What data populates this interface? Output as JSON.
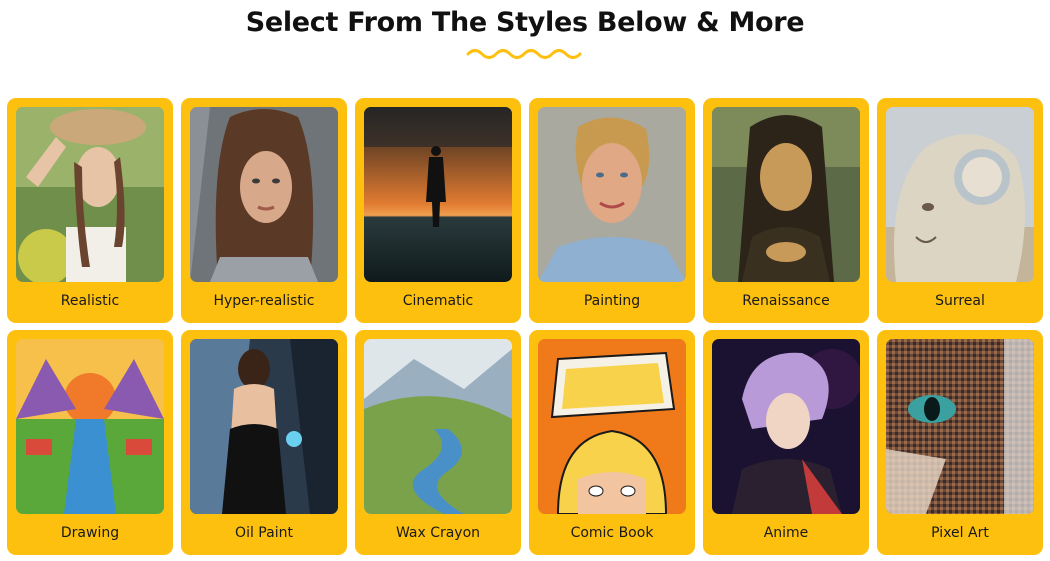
{
  "header": {
    "title": "Select From The Styles Below & More",
    "accent_color": "#FDC00F"
  },
  "styles": [
    {
      "label": "Realistic",
      "image": "woman-with-sun-hat-photo"
    },
    {
      "label": "Hyper-realistic",
      "image": "woman-portrait-photo"
    },
    {
      "label": "Cinematic",
      "image": "silhouette-sunset-sea"
    },
    {
      "label": "Painting",
      "image": "painted-portrait-woman"
    },
    {
      "label": "Renaissance",
      "image": "mona-lisa"
    },
    {
      "label": "Surreal",
      "image": "surreal-stone-face"
    },
    {
      "label": "Drawing",
      "image": "colored-landscape-drawing"
    },
    {
      "label": "Oil Paint",
      "image": "oil-painting-woman-glass"
    },
    {
      "label": "Wax Crayon",
      "image": "crayon-river-valley"
    },
    {
      "label": "Comic Book",
      "image": "comic-book-cover"
    },
    {
      "label": "Anime",
      "image": "anime-boy"
    },
    {
      "label": "Pixel Art",
      "image": "pixel-cat"
    }
  ],
  "card_color": "#FDC00F"
}
